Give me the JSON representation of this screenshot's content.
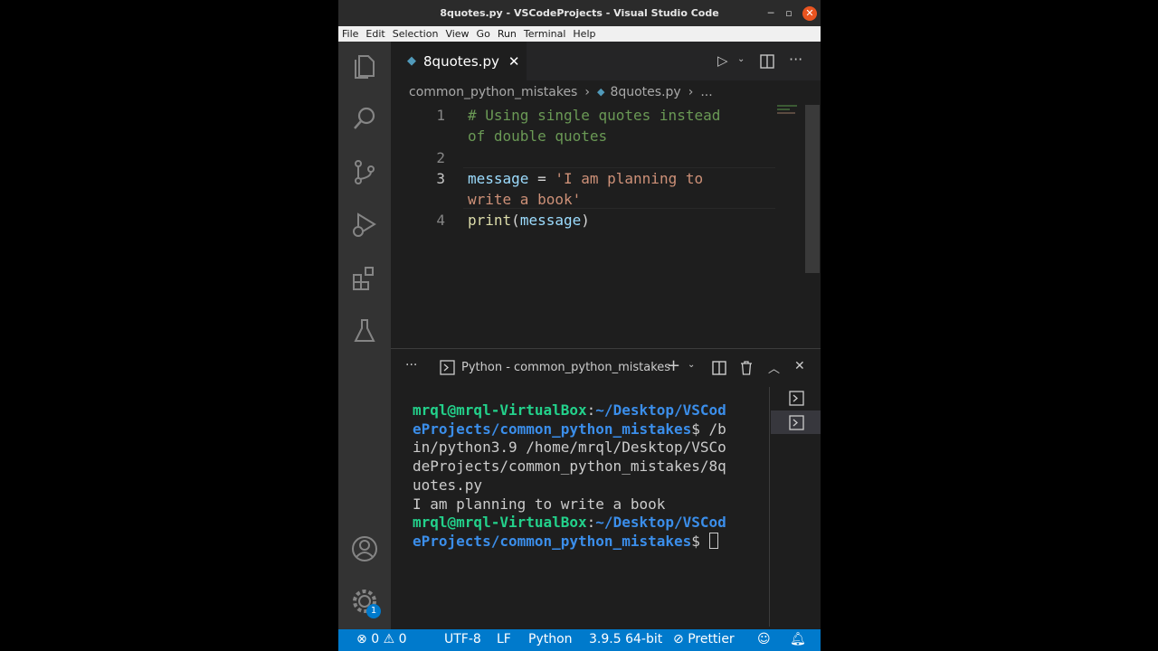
{
  "window": {
    "title": "8quotes.py - VSCodeProjects - Visual Studio Code"
  },
  "menu": [
    "File",
    "Edit",
    "Selection",
    "View",
    "Go",
    "Run",
    "Terminal",
    "Help"
  ],
  "activity_bar": {
    "items": [
      "files-icon",
      "search-icon",
      "source-control-icon",
      "run-debug-icon",
      "extensions-icon",
      "testing-icon"
    ],
    "bottom": [
      "account-icon",
      "manage-gear-icon"
    ],
    "settings_badge": "1"
  },
  "editor": {
    "tab_label": "8quotes.py",
    "breadcrumb": {
      "folder": "common_python_mistakes",
      "file": "8quotes.py",
      "more": "..."
    },
    "lines": [
      {
        "num": "1",
        "a": "# Using single quotes instead",
        "b": "of double quotes"
      },
      {
        "num": "2"
      },
      {
        "num": "3",
        "var": "message",
        "eq": " = ",
        "str1": "'I am planning to",
        "str2": "write a book'"
      },
      {
        "num": "4",
        "fn": "print",
        "p1": "(",
        "arg": "message",
        "p2": ")"
      }
    ]
  },
  "terminal": {
    "more": "···",
    "tab_label": "Python - common_python_mistakes",
    "prompt_user": "mrql@mrql-VirtualBox",
    "colon": ":",
    "path_line1": "~/Desktop/VSCod",
    "path_line2": "eProjects/common_python_mistakes",
    "dollar": "$ ",
    "cmd_tail": "/b",
    "cmd_lines": [
      "in/python3.9 /home/mrql/Desktop/VSCo",
      "deProjects/common_python_mistakes/8q",
      "uotes.py"
    ],
    "output": "I am planning to write a book",
    "path2_line1": "~/Desktop/VSCod",
    "path2_line2": "eProjects/common_python_mistakes",
    "dollar2": "$ "
  },
  "status_bar": {
    "errors": "0",
    "warnings": "0",
    "encoding": "UTF-8",
    "eol": "LF",
    "language": "Python",
    "interpreter": "3.9.5 64-bit",
    "formatter": "Prettier"
  },
  "colors": {
    "accent": "#007acc",
    "comment": "#6a9955",
    "string": "#ce9178",
    "variable": "#9cdcfe",
    "function": "#dcdcaa",
    "prompt_user": "#23d18b",
    "prompt_path": "#3b8eea"
  }
}
